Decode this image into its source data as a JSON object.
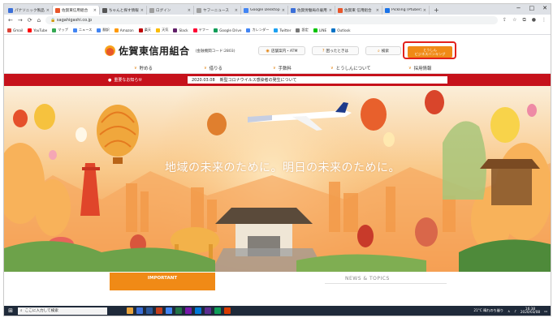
{
  "browser": {
    "tabs": [
      {
        "label": "パナソニック製品 サイト",
        "color": "#3b6fd8"
      },
      {
        "label": "佐賀東信用組合",
        "color": "#e8562a"
      },
      {
        "label": "ちゃんと探す情報サイト",
        "color": "#555555"
      },
      {
        "label": "ログイン",
        "color": "#9e9e9e"
      },
      {
        "label": "ヤフーニュース",
        "color": "#9e9e9e"
      },
      {
        "label": "Google Desktop for",
        "color": "#4285f4"
      },
      {
        "label": "佐賀労働局の雇用",
        "color": "#3b6fd8"
      },
      {
        "label": "佐賀東 信用組合",
        "color": "#e8562a"
      },
      {
        "label": "Pickling (Ptuber)",
        "color": "#1a73e8"
      }
    ],
    "new_tab": "+",
    "window_controls": [
      "−",
      "□",
      "✕"
    ],
    "url": "sagahigashi.co.jp",
    "bookmarks": [
      {
        "label": "Gmail",
        "color": "#db4437"
      },
      {
        "label": "YouTube",
        "color": "#ff0000"
      },
      {
        "label": "マップ",
        "color": "#34a853"
      },
      {
        "label": "ニュース",
        "color": "#4285f4"
      },
      {
        "label": "翻訳",
        "color": "#4285f4"
      },
      {
        "label": "Amazon",
        "color": "#ff9900"
      },
      {
        "label": "楽天",
        "color": "#bf0000"
      },
      {
        "label": "天気",
        "color": "#fbbc05"
      },
      {
        "label": "Slack",
        "color": "#611f69"
      },
      {
        "label": "ヤフー",
        "color": "#ff0033"
      },
      {
        "label": "Google Drive",
        "color": "#0f9d58"
      },
      {
        "label": "カレンダー",
        "color": "#4285f4"
      },
      {
        "label": "Twitter",
        "color": "#1da1f2"
      },
      {
        "label": "設定",
        "color": "#777777"
      },
      {
        "label": "LINE",
        "color": "#00c300"
      },
      {
        "label": "Outlook",
        "color": "#0072c6"
      }
    ]
  },
  "site": {
    "logo_name": "佐賀東信用組合",
    "logo_code": "(金融機関コード:2803)",
    "header_buttons": [
      {
        "label": "店舗案内・ATM",
        "icon": "pin-icon"
      },
      {
        "label": "困ったときは",
        "icon": "help-icon"
      },
      {
        "label": "検索",
        "icon": "search-icon"
      }
    ],
    "business_button": "とうしん\nビジネスバンキング",
    "nav": [
      "貯める",
      "借りる",
      "手数料",
      "とうしんについて",
      "採用情報"
    ],
    "notice_label": "重要なお知らせ",
    "notice_date": "2020.03.08",
    "notice_text": "新型コロナウイルス感染者の発生について",
    "hero_copy": "地域の未来のために。明日の未来のために。",
    "important_label": "IMPORTANT",
    "news_label": "NEWS & TOPICS"
  },
  "taskbar": {
    "search_placeholder": "ここに入力して検索",
    "apps": [
      "#e8a33d",
      "#3b6fd8",
      "#2b579a",
      "#c43e1c",
      "#4285f4",
      "#217346",
      "#7719aa",
      "#0078d7",
      "#5c2d91",
      "#0f9d58",
      "#d83b01"
    ],
    "clock_time": "16:38",
    "clock_date": "2020/03/08",
    "tray_text": "21°C 晴れのち曇り"
  },
  "colors": {
    "brand_orange": "#f08a16",
    "notice_red": "#c6111b",
    "highlight": "#e2211c"
  }
}
